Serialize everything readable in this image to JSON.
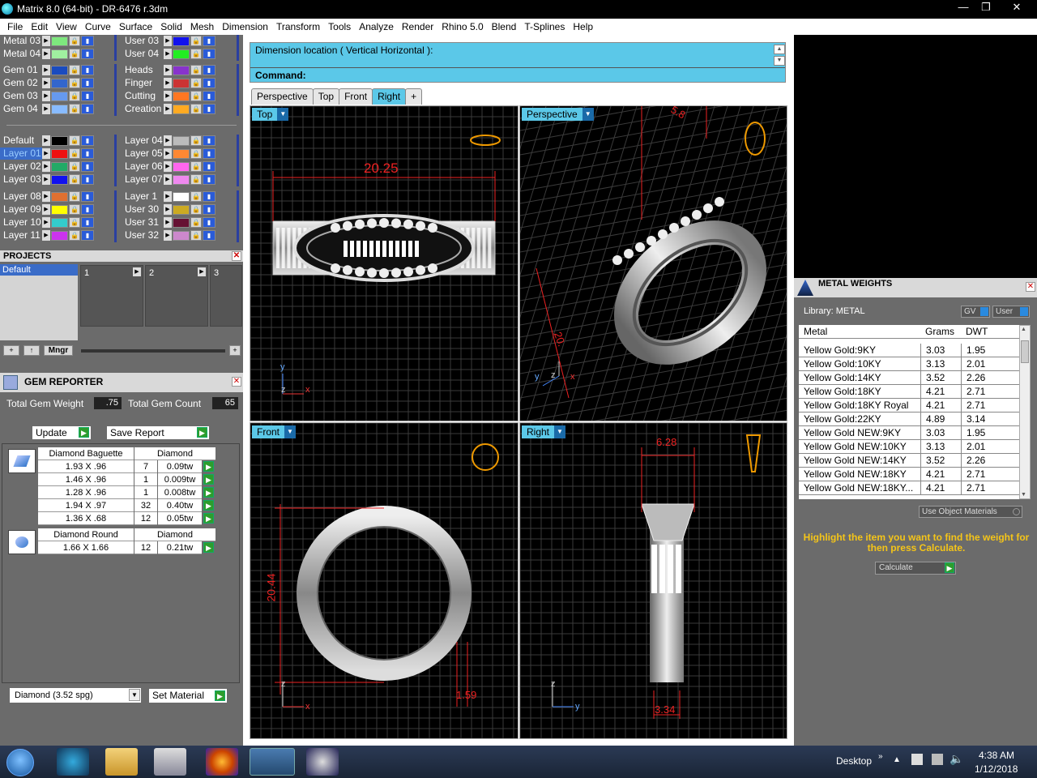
{
  "window": {
    "title": "Matrix 8.0 (64-bit) - DR-6476 r.3dm",
    "min": "—",
    "max": "❐",
    "close": "✕"
  },
  "menu": [
    "File",
    "Edit",
    "View",
    "Curve",
    "Surface",
    "Solid",
    "Mesh",
    "Dimension",
    "Transform",
    "Tools",
    "Analyze",
    "Render",
    "Rhino 5.0",
    "Blend",
    "T-Splines",
    "Help"
  ],
  "layers_left": [
    {
      "name": "Metal 03",
      "color": "#7ee87e"
    },
    {
      "name": "Metal 04",
      "color": "#a0f0a0"
    },
    {
      "name": "Gem 01",
      "color": "#1a4bbf"
    },
    {
      "name": "Gem 02",
      "color": "#3366cc"
    },
    {
      "name": "Gem 03",
      "color": "#6699ee"
    },
    {
      "name": "Gem 04",
      "color": "#88bbff"
    },
    {
      "name": "Default",
      "color": "#000000"
    },
    {
      "name": "Layer 01",
      "color": "#ee1111"
    },
    {
      "name": "Layer 02",
      "color": "#22aa66"
    },
    {
      "name": "Layer 03",
      "color": "#1111ee"
    },
    {
      "name": "Layer 08",
      "color": "#e07030"
    },
    {
      "name": "Layer 09",
      "color": "#ffff00"
    },
    {
      "name": "Layer 10",
      "color": "#33cccc"
    },
    {
      "name": "Layer 11",
      "color": "#cc33ee"
    }
  ],
  "layers_right": [
    {
      "name": "User 03",
      "color": "#1111ee"
    },
    {
      "name": "User 04",
      "color": "#22ee22"
    },
    {
      "name": "Heads",
      "color": "#8833cc"
    },
    {
      "name": "Finger",
      "color": "#cc3333"
    },
    {
      "name": "Cutting",
      "color": "#ff7722"
    },
    {
      "name": "Creation",
      "color": "#ffaa22"
    },
    {
      "name": "Layer 04",
      "color": "#bbbbbb"
    },
    {
      "name": "Layer 05",
      "color": "#ff8833"
    },
    {
      "name": "Layer 06",
      "color": "#ff66ee"
    },
    {
      "name": "Layer 07",
      "color": "#ee88ee"
    },
    {
      "name": "Layer 1",
      "color": "#ffffff"
    },
    {
      "name": "User 30",
      "color": "#ccaa22"
    },
    {
      "name": "User 31",
      "color": "#661133"
    },
    {
      "name": "User 32",
      "color": "#cc88cc"
    }
  ],
  "projects": {
    "title": "PROJECTS",
    "default": "Default",
    "slots": [
      "1",
      "2",
      "3"
    ],
    "mngr": "Mngr"
  },
  "gem_reporter": {
    "title": "GEM REPORTER",
    "total_weight_label": "Total Gem Weight",
    "total_weight": ".75",
    "total_count_label": "Total Gem Count",
    "total_count": "65",
    "update": "Update",
    "save_report": "Save Report",
    "baguette": {
      "name": "Diamond Baguette",
      "material": "Diamond",
      "rows": [
        [
          "1.93 X .96",
          "7",
          "0.09tw"
        ],
        [
          "1.46 X .96",
          "1",
          "0.009tw"
        ],
        [
          "1.28 X .96",
          "1",
          "0.008tw"
        ],
        [
          "1.94 X .97",
          "32",
          "0.40tw"
        ],
        [
          "1.36 X .68",
          "12",
          "0.05tw"
        ]
      ]
    },
    "round": {
      "name": "Diamond Round",
      "material": "Diamond",
      "rows": [
        [
          "1.66 X 1.66",
          "12",
          "0.21tw"
        ]
      ]
    },
    "material_select": "Diamond    (3.52 spg)",
    "set_material": "Set Material"
  },
  "command": {
    "prompt": "Dimension location ( Vertical  Horizontal ):",
    "label": "Command:"
  },
  "tabs": [
    "Perspective",
    "Top",
    "Front",
    "Right",
    "+"
  ],
  "viewports": {
    "top": {
      "label": "Top",
      "dim": "20.25"
    },
    "perspective": {
      "label": "Perspective",
      "dim1": "20.",
      "dim2": "5.8"
    },
    "front": {
      "label": "Front",
      "dim1": "20.44",
      "dim2": "1.59"
    },
    "right": {
      "label": "Right",
      "dim1": "6.28",
      "dim2": "3.34"
    }
  },
  "axes": {
    "x": "x",
    "y": "y",
    "z": "z"
  },
  "metal_weights": {
    "title": "METAL WEIGHTS",
    "library": "Library: METAL",
    "gv": "GV",
    "user": "User",
    "cols": [
      "Metal",
      "Grams",
      "DWT"
    ],
    "rows": [
      [
        "Yellow Gold:9KY",
        "3.03",
        "1.95"
      ],
      [
        "Yellow Gold:10KY",
        "3.13",
        "2.01"
      ],
      [
        "Yellow Gold:14KY",
        "3.52",
        "2.26"
      ],
      [
        "Yellow Gold:18KY",
        "4.21",
        "2.71"
      ],
      [
        "Yellow Gold:18KY Royal",
        "4.21",
        "2.71"
      ],
      [
        "Yellow Gold:22KY",
        "4.89",
        "3.14"
      ],
      [
        "Yellow Gold NEW:9KY",
        "3.03",
        "1.95"
      ],
      [
        "Yellow Gold NEW:10KY",
        "3.13",
        "2.01"
      ],
      [
        "Yellow Gold NEW:14KY",
        "3.52",
        "2.26"
      ],
      [
        "Yellow Gold NEW:18KY",
        "4.21",
        "2.71"
      ],
      [
        "Yellow Gold NEW:18KY...",
        "4.21",
        "2.71"
      ]
    ],
    "use_object": "Use Object Materials",
    "hint": "Highlight the item you want to find the weight for then press Calculate.",
    "calculate": "Calculate"
  },
  "taskbar": {
    "desktop": "Desktop",
    "time": "4:38 AM",
    "date": "1/12/2018"
  }
}
